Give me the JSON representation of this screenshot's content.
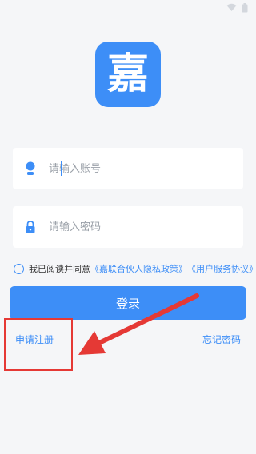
{
  "status_bar": {
    "time": ""
  },
  "logo": {
    "char": "嘉"
  },
  "account_field": {
    "placeholder": "请输入账号",
    "value": ""
  },
  "password_field": {
    "placeholder": "请输入密码",
    "value": ""
  },
  "agreement": {
    "prefix": "我已阅读并同意",
    "privacy_policy": "《嘉联合伙人隐私政策》",
    "user_agreement": "《用户服务协议》"
  },
  "login_button": {
    "label": "登录"
  },
  "register_link": {
    "label": "申请注册"
  },
  "forgot_password_link": {
    "label": "忘记密码"
  },
  "colors": {
    "accent": "#3d8ef7",
    "annotation": "#e53935",
    "background": "#f5f6f8"
  },
  "annotations": {
    "highlight_target": "register_link",
    "arrow": "red-arrow-pointing-to-register"
  }
}
